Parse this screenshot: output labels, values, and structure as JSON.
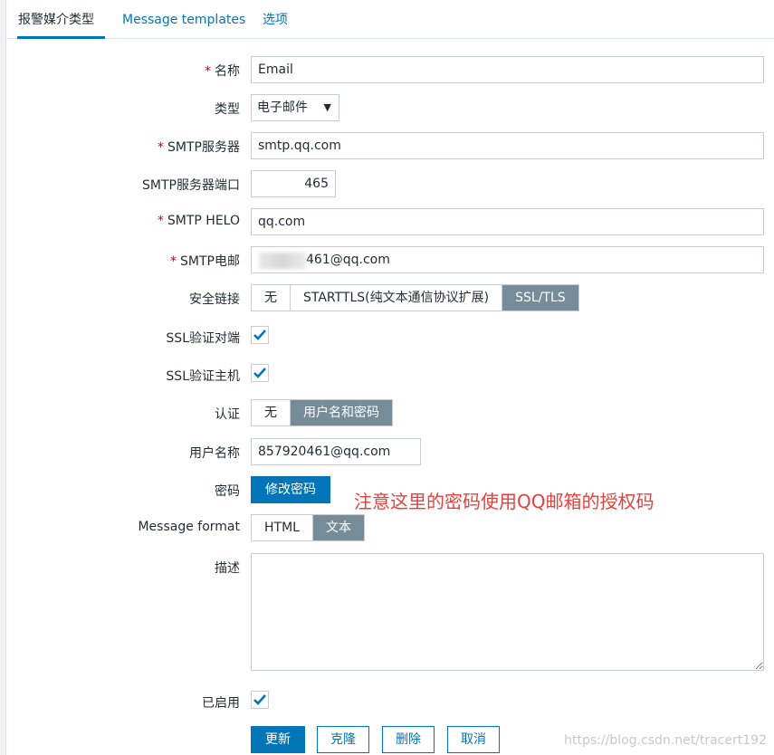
{
  "tabs": [
    {
      "label": "报警媒介类型",
      "active": true
    },
    {
      "label": "Message templates",
      "active": false
    },
    {
      "label": "选项",
      "active": false
    }
  ],
  "form": {
    "name": {
      "label": "名称",
      "value": "Email",
      "required": true
    },
    "type": {
      "label": "类型",
      "value": "电子邮件"
    },
    "smtp_server": {
      "label": "SMTP服务器",
      "value": "smtp.qq.com",
      "required": true
    },
    "smtp_port": {
      "label": "SMTP服务器端口",
      "value": "465"
    },
    "smtp_helo": {
      "label": "SMTP HELO",
      "value": "qq.com",
      "required": true
    },
    "smtp_email": {
      "label": "SMTP电邮",
      "value": "461@qq.com",
      "required": true
    },
    "security": {
      "label": "安全链接",
      "options": [
        "无",
        "STARTTLS(纯文本通信协议扩展)",
        "SSL/TLS"
      ],
      "selected": "SSL/TLS"
    },
    "ssl_verify_peer": {
      "label": "SSL验证对端",
      "checked": true
    },
    "ssl_verify_host": {
      "label": "SSL验证主机",
      "checked": true
    },
    "auth": {
      "label": "认证",
      "options": [
        "无",
        "用户名和密码"
      ],
      "selected": "用户名和密码"
    },
    "username": {
      "label": "用户名称",
      "value": "857920461@qq.com"
    },
    "password": {
      "label": "密码",
      "button": "修改密码"
    },
    "message_format": {
      "label": "Message format",
      "options": [
        "HTML",
        "文本"
      ],
      "selected": "文本"
    },
    "description": {
      "label": "描述",
      "value": ""
    },
    "enabled": {
      "label": "已启用",
      "checked": true
    }
  },
  "annotation": "注意这里的密码使用QQ邮箱的授权码",
  "actions": {
    "update": "更新",
    "clone": "克隆",
    "delete": "删除",
    "cancel": "取消"
  },
  "watermark": "https://blog.csdn.net/tracert192",
  "colors": {
    "accent": "#0275b8",
    "selected_segment": "#768d99",
    "required": "#d40000",
    "annotation": "#e8403b"
  }
}
